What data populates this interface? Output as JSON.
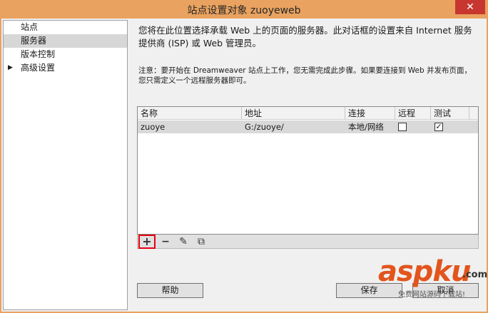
{
  "window": {
    "title": "站点设置对象 zuoyeweb",
    "close_glyph": "✕"
  },
  "categories": [
    {
      "label": "站点",
      "selected": false,
      "has_arrow": false
    },
    {
      "label": "服务器",
      "selected": true,
      "has_arrow": false
    },
    {
      "label": "版本控制",
      "selected": false,
      "has_arrow": false
    },
    {
      "label": "高级设置",
      "selected": false,
      "has_arrow": true
    }
  ],
  "panel": {
    "description": "您将在此位置选择承载 Web 上的页面的服务器。此对话框的设置来自 Internet 服务提供商 (ISP) 或 Web 管理员。",
    "note": "注意：要开始在 Dreamweaver 站点上工作，您无需完成此步骤。如果要连接到 Web 并发布页面，您只需定义一个远程服务器即可。"
  },
  "server_table": {
    "columns": [
      "名称",
      "地址",
      "连接",
      "远程",
      "测试"
    ],
    "rows": [
      {
        "name": "zuoye",
        "address": "G:/zuoye/",
        "connection": "本地/网络",
        "remote": false,
        "test": true
      }
    ]
  },
  "toolbar": {
    "add_glyph": "+",
    "remove_glyph": "−",
    "edit_glyph": "✎",
    "duplicate_glyph": "⧉"
  },
  "buttons": {
    "help": "帮助",
    "save": "保存",
    "cancel": "取消"
  },
  "watermark": {
    "brand": "aspku",
    "suffix": ".com",
    "subtitle": "免费网站源码下载站!"
  },
  "colors": {
    "title_bar": "#e9a25f",
    "close_button": "#c7372f",
    "highlight_box": "#e60012",
    "watermark": "#e2551c"
  }
}
